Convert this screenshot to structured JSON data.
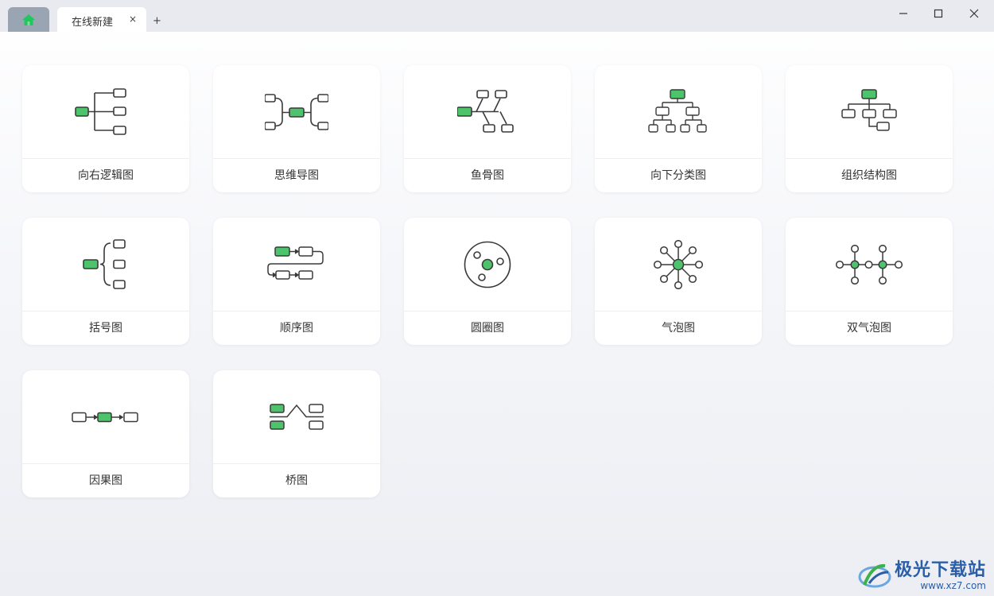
{
  "tabs": {
    "home_icon": "home-icon",
    "active_label": "在线新建",
    "close_label": "×",
    "add_label": "+"
  },
  "colors": {
    "accent_green": "#4dc46b",
    "stroke": "#3a3a3a"
  },
  "cards": [
    {
      "label": "向右逻辑图",
      "icon": "right-logic-chart-icon"
    },
    {
      "label": "思维导图",
      "icon": "mind-map-icon"
    },
    {
      "label": "鱼骨图",
      "icon": "fishbone-icon"
    },
    {
      "label": "向下分类图",
      "icon": "downward-classification-icon"
    },
    {
      "label": "组织结构图",
      "icon": "org-chart-icon"
    },
    {
      "label": "括号图",
      "icon": "bracket-chart-icon"
    },
    {
      "label": "顺序图",
      "icon": "sequence-chart-icon"
    },
    {
      "label": "圆圈图",
      "icon": "circle-map-icon"
    },
    {
      "label": "气泡图",
      "icon": "bubble-map-icon"
    },
    {
      "label": "双气泡图",
      "icon": "double-bubble-map-icon"
    },
    {
      "label": "因果图",
      "icon": "cause-effect-icon"
    },
    {
      "label": "桥图",
      "icon": "bridge-map-icon"
    }
  ],
  "watermark": {
    "title": "极光下载站",
    "url": "www.xz7.com"
  }
}
